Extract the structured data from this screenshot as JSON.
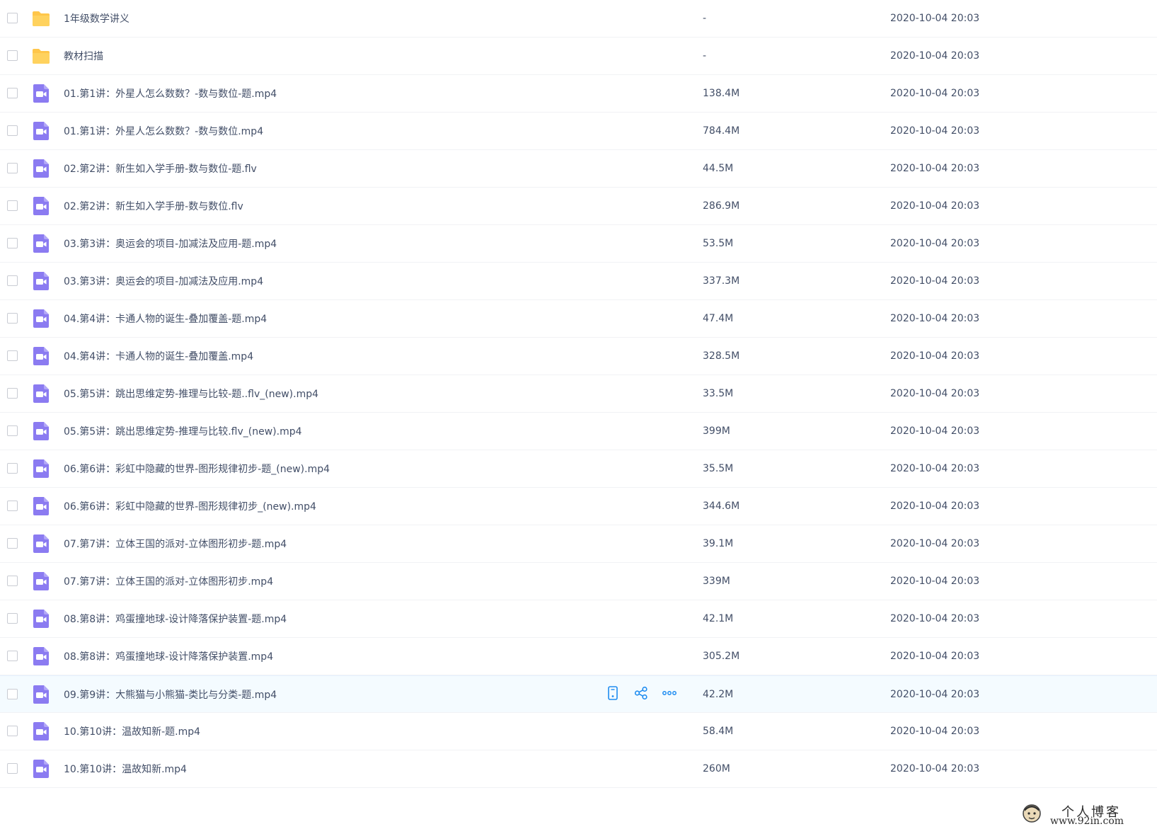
{
  "colors": {
    "folder": "#ffc64a",
    "video": "#8b7bf1",
    "action_icon": "#1e8cf0",
    "text": "#424e67"
  },
  "files": [
    {
      "type": "folder",
      "icon": "folder-icon",
      "name": "1年级数学讲义",
      "size": "-",
      "date": "2020-10-04 20:03"
    },
    {
      "type": "folder",
      "icon": "folder-icon",
      "name": "教材扫描",
      "size": "-",
      "date": "2020-10-04 20:03"
    },
    {
      "type": "video",
      "icon": "video-file-icon",
      "name": "01.第1讲：外星人怎么数数？-数与数位-题.mp4",
      "size": "138.4M",
      "date": "2020-10-04 20:03"
    },
    {
      "type": "video",
      "icon": "video-file-icon",
      "name": "01.第1讲：外星人怎么数数？-数与数位.mp4",
      "size": "784.4M",
      "date": "2020-10-04 20:03"
    },
    {
      "type": "video",
      "icon": "video-file-icon",
      "name": "02.第2讲：新生如入学手册-数与数位-题.flv",
      "size": "44.5M",
      "date": "2020-10-04 20:03"
    },
    {
      "type": "video",
      "icon": "video-file-icon",
      "name": "02.第2讲：新生如入学手册-数与数位.flv",
      "size": "286.9M",
      "date": "2020-10-04 20:03"
    },
    {
      "type": "video",
      "icon": "video-file-icon",
      "name": "03.第3讲：奥运会的项目-加减法及应用-题.mp4",
      "size": "53.5M",
      "date": "2020-10-04 20:03"
    },
    {
      "type": "video",
      "icon": "video-file-icon",
      "name": "03.第3讲：奥运会的项目-加减法及应用.mp4",
      "size": "337.3M",
      "date": "2020-10-04 20:03"
    },
    {
      "type": "video",
      "icon": "video-file-icon",
      "name": "04.第4讲：卡通人物的诞生-叠加覆盖-题.mp4",
      "size": "47.4M",
      "date": "2020-10-04 20:03"
    },
    {
      "type": "video",
      "icon": "video-file-icon",
      "name": "04.第4讲：卡通人物的诞生-叠加覆盖.mp4",
      "size": "328.5M",
      "date": "2020-10-04 20:03"
    },
    {
      "type": "video",
      "icon": "video-file-icon",
      "name": "05.第5讲：跳出思维定势-推理与比较-题..flv_(new).mp4",
      "size": "33.5M",
      "date": "2020-10-04 20:03"
    },
    {
      "type": "video",
      "icon": "video-file-icon",
      "name": "05.第5讲：跳出思维定势-推理与比较.flv_(new).mp4",
      "size": "399M",
      "date": "2020-10-04 20:03"
    },
    {
      "type": "video",
      "icon": "video-file-icon",
      "name": "06.第6讲：彩虹中隐藏的世界-图形规律初步-题_(new).mp4",
      "size": "35.5M",
      "date": "2020-10-04 20:03"
    },
    {
      "type": "video",
      "icon": "video-file-icon",
      "name": "06.第6讲：彩虹中隐藏的世界-图形规律初步_(new).mp4",
      "size": "344.6M",
      "date": "2020-10-04 20:03"
    },
    {
      "type": "video",
      "icon": "video-file-icon",
      "name": "07.第7讲：立体王国的派对-立体图形初步-题.mp4",
      "size": "39.1M",
      "date": "2020-10-04 20:03"
    },
    {
      "type": "video",
      "icon": "video-file-icon",
      "name": "07.第7讲：立体王国的派对-立体图形初步.mp4",
      "size": "339M",
      "date": "2020-10-04 20:03"
    },
    {
      "type": "video",
      "icon": "video-file-icon",
      "name": "08.第8讲：鸡蛋撞地球-设计降落保护装置-题.mp4",
      "size": "42.1M",
      "date": "2020-10-04 20:03"
    },
    {
      "type": "video",
      "icon": "video-file-icon",
      "name": "08.第8讲：鸡蛋撞地球-设计降落保护装置.mp4",
      "size": "305.2M",
      "date": "2020-10-04 20:03"
    },
    {
      "type": "video",
      "icon": "video-file-icon",
      "name": "09.第9讲：大熊猫与小熊猫-类比与分类-题.mp4",
      "size": "42.2M",
      "date": "2020-10-04 20:03",
      "hover": true,
      "actions": [
        "phone-icon",
        "share-icon",
        "more-icon"
      ]
    },
    {
      "type": "video",
      "icon": "video-file-icon",
      "name": "10.第10讲：温故知新-题.mp4",
      "size": "58.4M",
      "date": "2020-10-04 20:03"
    },
    {
      "type": "video",
      "icon": "video-file-icon",
      "name": "10.第10讲：温故知新.mp4",
      "size": "260M",
      "date": "2020-10-04 20:03"
    }
  ],
  "watermark": {
    "title": "个人博客",
    "url": "www.92in.com"
  }
}
